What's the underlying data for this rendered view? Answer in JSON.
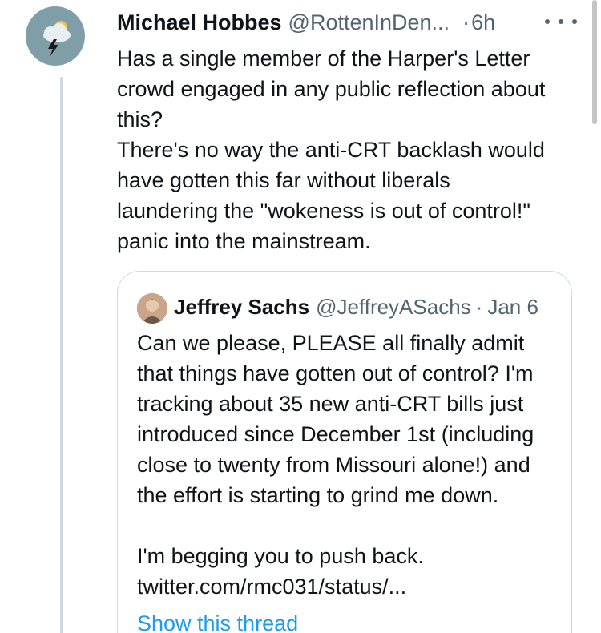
{
  "tweet": {
    "author_name": "Michael Hobbes",
    "author_handle": "@RottenInDen...",
    "separator": "·",
    "time": "6h",
    "more_icon": "more-horizontal-icon",
    "avatar_icon": "storm-cloud-icon",
    "text_lines": [
      "Has a single member of the Harper's Letter",
      "crowd engaged in any public reflection about",
      "this?",
      "There's no way the anti-CRT backlash would",
      "have gotten this far without liberals",
      "laundering the \"wokeness is out of control!\"",
      "panic into the mainstream."
    ]
  },
  "quoted_tweet": {
    "author_name": "Jeffrey Sachs",
    "author_handle": "@JeffreyASachs",
    "separator": "·",
    "time": "Jan 6",
    "text_lines": [
      "Can we please, PLEASE all finally admit",
      "that things have gotten out of control? I'm",
      "tracking about 35 new anti-CRT bills just",
      "introduced since December 1st (including",
      "close to twenty from Missouri alone!) and",
      "the effort is starting to grind me down.",
      "",
      "I'm begging you to push back.",
      "twitter.com/rmc031/status/..."
    ],
    "show_thread": "Show this thread"
  },
  "colors": {
    "accent": "#1d9bf0",
    "secondary_text": "#536471",
    "border": "#cfd9de"
  }
}
